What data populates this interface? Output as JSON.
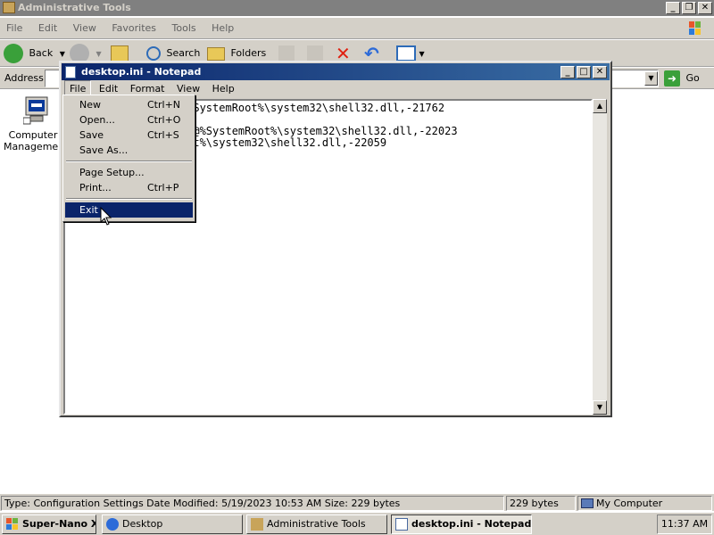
{
  "explorer": {
    "title": "Administrative Tools",
    "menu": [
      "File",
      "Edit",
      "View",
      "Favorites",
      "Tools",
      "Help"
    ],
    "toolbar": {
      "back": "Back",
      "search": "Search",
      "folders": "Folders"
    },
    "address_label": "Address",
    "go_label": "Go",
    "icon_label": "Computer Management",
    "status": {
      "info": "Type: Configuration Settings Date Modified: 5/19/2023 10:53 AM Size: 229 bytes",
      "size": "229 bytes",
      "zone": "My Computer"
    }
  },
  "notepad": {
    "title": "desktop.ini - Notepad",
    "menu": [
      "File",
      "Edit",
      "Format",
      "View",
      "Help"
    ],
    "content_lines": [
      "",
      "ame=@%SystemRoot%\\system32\\shell32.dll,-21762",
      "s]",
      "t.lnk=@%SystemRoot%\\system32\\shell32.dll,-22023",
      "temRoot%\\system32\\shell32.dll,-22059"
    ]
  },
  "file_menu": {
    "new": "New",
    "new_sc": "Ctrl+N",
    "open": "Open...",
    "open_sc": "Ctrl+O",
    "save": "Save",
    "save_sc": "Ctrl+S",
    "save_as": "Save As...",
    "page_setup": "Page Setup...",
    "print": "Print...",
    "print_sc": "Ctrl+P",
    "exit": "Exit"
  },
  "taskbar": {
    "start": "Super-Nano XP",
    "buttons": [
      "Desktop",
      "Administrative Tools",
      "desktop.ini - Notepad"
    ],
    "clock": "11:37 AM"
  },
  "colors": {
    "title_active": "#0a246a",
    "title_inactive": "#808080",
    "face": "#d4d0c8"
  }
}
